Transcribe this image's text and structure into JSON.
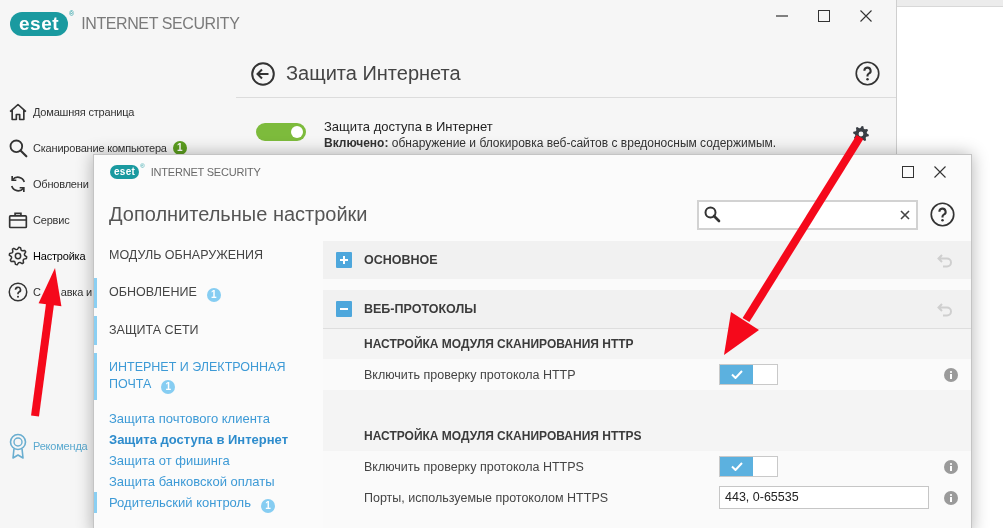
{
  "main_window": {
    "logo": "eset",
    "logo_mark": "®",
    "product": "INTERNET SECURITY",
    "sidebar": {
      "items": [
        {
          "label": "Домашняя страница",
          "selected": false
        },
        {
          "label": "Сканирование компьютера",
          "badge": "1",
          "selected": false
        },
        {
          "label": "Обновлени",
          "selected": false
        },
        {
          "label": "Сервис",
          "selected": false
        },
        {
          "label": "Настройка",
          "selected": true
        },
        {
          "label_parts": [
            "С",
            "авка и"
          ],
          "selected": false
        }
      ],
      "footer": {
        "label": "Рекоменда"
      }
    },
    "page": {
      "title": "Защита Интернета",
      "feature": {
        "title": "Защита доступа в Интернет",
        "description": "**Включено:** обнаружение и блокировка веб-сайтов с вредоносным содержимым.",
        "on": true
      }
    }
  },
  "dialog": {
    "logo": "eset",
    "logo_mark": "®",
    "product": "INTERNET SECURITY",
    "title": "Дополнительные настройки",
    "nav": [
      {
        "label": "МОДУЛЬ ОБНАРУЖЕНИЯ",
        "selected": false,
        "modified": false
      },
      {
        "label": "ОБНОВЛЕНИЕ",
        "badge": "1",
        "selected": false,
        "modified": true
      },
      {
        "label": "ЗАЩИТА СЕТИ",
        "selected": false,
        "modified": true
      },
      {
        "label": "ИНТЕРНЕТ И ЭЛЕКТРОННАЯ ПОЧТА",
        "badge": "1",
        "selected": true,
        "modified": true,
        "children": [
          {
            "label": "Защита почтового клиента",
            "selected": false,
            "modified": false
          },
          {
            "label": "Защита доступа в Интернет",
            "selected": true,
            "modified": false
          },
          {
            "label": "Защита от фишинга",
            "selected": false,
            "modified": false
          },
          {
            "label": "Защита банковской оплаты",
            "selected": false,
            "modified": false
          },
          {
            "label": "Родительский контроль",
            "badge": "1",
            "selected": false,
            "modified": true
          }
        ]
      }
    ],
    "sections": [
      {
        "title": "ОСНОВНОЕ",
        "expanded": false
      },
      {
        "title": "ВЕБ-ПРОТОКОЛЫ",
        "expanded": true,
        "groups": [
          {
            "title": "НАСТРОЙКА МОДУЛЯ СКАНИРОВАНИЯ HTTP",
            "rows": [
              {
                "kind": "toggle",
                "label": "Включить проверку протокола HTTP",
                "on": true
              }
            ]
          },
          {
            "title": "НАСТРОЙКА МОДУЛЯ СКАНИРОВАНИЯ HTTPS",
            "rows": [
              {
                "kind": "toggle",
                "label": "Включить проверку протокола HTTPS",
                "on": true
              },
              {
                "kind": "text",
                "label": "Порты, используемые протоколом HTTPS",
                "value": "443, 0-65535"
              }
            ]
          }
        ]
      }
    ]
  }
}
